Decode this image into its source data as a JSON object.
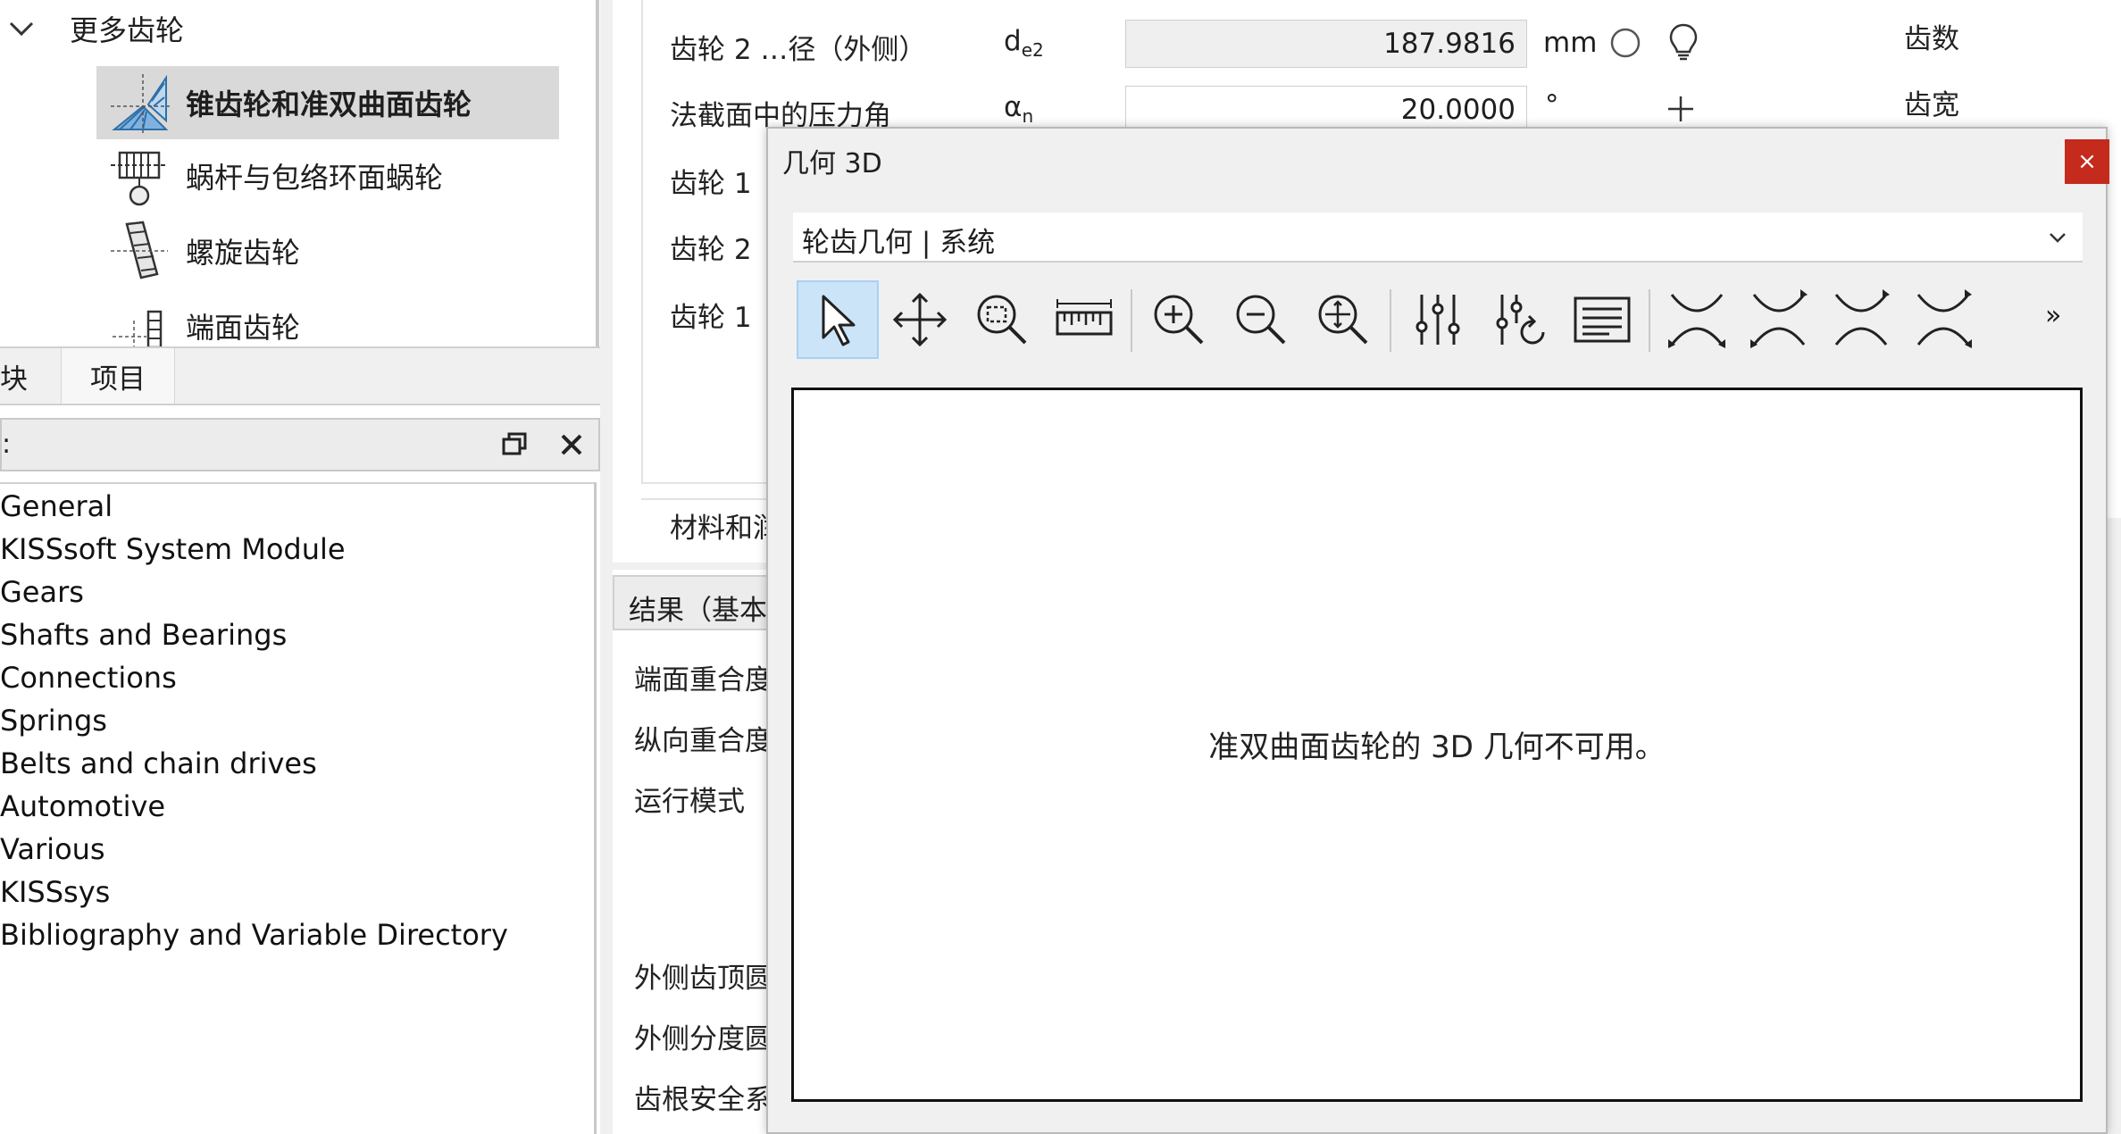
{
  "tree": {
    "group_label": "更多齿轮",
    "items": [
      {
        "label": "锥齿轮和准双曲面齿轮",
        "icon": "bevel-gear-icon",
        "selected": true
      },
      {
        "label": "蜗杆与包络环面蜗轮",
        "icon": "worm-gear-icon",
        "selected": false
      },
      {
        "label": "螺旋齿轮",
        "icon": "crossed-helical-gear-icon",
        "selected": false
      },
      {
        "label": "端面齿轮",
        "icon": "face-gear-icon",
        "selected": false
      }
    ]
  },
  "tabs": [
    {
      "label": "块"
    },
    {
      "label": "项目"
    }
  ],
  "module_panel": {
    "title": ":",
    "items": [
      "General",
      "KISSsoft System Module",
      "Gears",
      "Shafts and Bearings",
      "Connections",
      "Springs",
      "Belts and chain drives",
      "Automotive",
      "Various",
      "KISSsys",
      "Bibliography and Variable Directory"
    ]
  },
  "form": {
    "rows": [
      {
        "label": "齿轮 2 …径（外侧）",
        "symbol": "d",
        "sub": "e2",
        "value": "187.9816",
        "unit": "mm"
      },
      {
        "label": "法截面中的压力角",
        "symbol": "α",
        "sub": "n",
        "value": "20.0000",
        "unit": "°"
      },
      {
        "label": "齿轮 1"
      },
      {
        "label": "齿轮 2"
      },
      {
        "label": "齿轮 1"
      }
    ],
    "right_labels": [
      "齿数",
      "齿宽"
    ],
    "material_group_label": "材料和润"
  },
  "results": {
    "title": "结果（基本",
    "rows": [
      "端面重合度",
      "纵向重合度",
      "运行模式",
      "外侧齿顶圆",
      "外侧分度圆",
      "齿根安全系"
    ]
  },
  "dialog": {
    "title": "几何 3D",
    "close_label": "×",
    "view_select": "轮齿几何 | 系统",
    "toolbar_more": "»",
    "message": "准双曲面齿轮的 3D 几何不可用。"
  },
  "colors": {
    "selected_bg": "#d9d9d9",
    "active_tool_bg": "#cce4f7",
    "close_red": "#c42b1c"
  }
}
